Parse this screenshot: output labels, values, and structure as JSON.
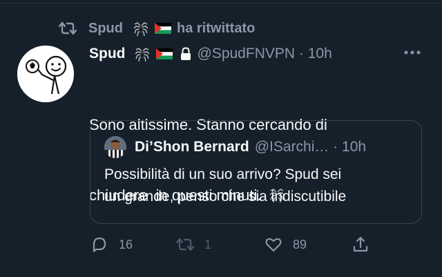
{
  "retweet": {
    "label": "ha ritwittato",
    "retweeter": "Spud"
  },
  "tweet": {
    "display_name": "Spud",
    "handle": "@SpudFNVPN",
    "time": "10h",
    "line1": "Sono altissime. Stanno cercando di",
    "line2": "chiudere  in questi minuti."
  },
  "quote": {
    "display_name": "Di’Shon Bernard",
    "handle": "@ISarchi…",
    "time": "10h",
    "line1": "Possibilità di un suo arrivo? Spud sei",
    "line2": "un grande, penso che sia indiscutibile"
  },
  "actions": {
    "replies": "16",
    "retweets": "1",
    "likes": "89"
  },
  "colors": {
    "background": "#15202b",
    "muted": "#8b98a5",
    "text": "#f7f9f9",
    "border": "#38444d"
  },
  "icons": [
    "retweet-icon",
    "spider-icon",
    "palestine-flag-icon",
    "lock-icon",
    "more-icon",
    "reply-icon",
    "like-icon",
    "share-icon"
  ]
}
